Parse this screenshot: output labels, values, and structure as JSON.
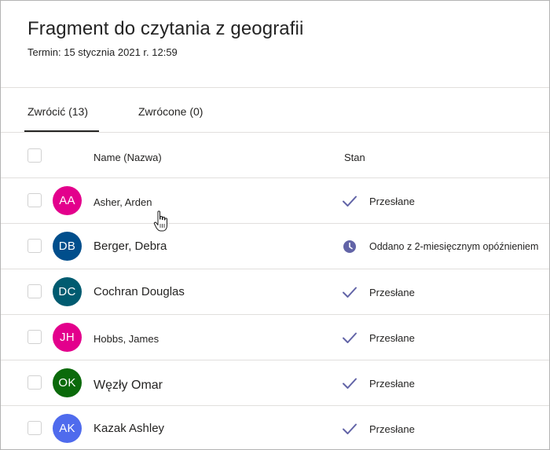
{
  "header": {
    "title": "Fragment do czytania z geografii",
    "due": "Termin: 15 stycznia 2021 r. 12:59"
  },
  "tabs": [
    {
      "label": "Zwrócić (13)",
      "active": true
    },
    {
      "label": "Zwrócone (0)",
      "active": false
    }
  ],
  "columns": {
    "name": "Name (Nazwa)",
    "status": "Stan"
  },
  "students": [
    {
      "initials": "AA",
      "name": "Asher, Arden",
      "status": "Przesłane",
      "status_icon": "check-icon",
      "avatar_color": "#e3008c"
    },
    {
      "initials": "DB",
      "name": "Berger, Debra",
      "status": "Oddano z 2-miesięcznym opóźnieniem",
      "status_icon": "clock-icon",
      "avatar_color": "#004e8c"
    },
    {
      "initials": "DC",
      "name": "Cochran Douglas",
      "status": "Przesłane",
      "status_icon": "check-icon",
      "avatar_color": "#005b70"
    },
    {
      "initials": "JH",
      "name": "Hobbs, James",
      "status": "Przesłane",
      "status_icon": "check-icon",
      "avatar_color": "#e3008c"
    },
    {
      "initials": "OK",
      "name": "Węzły Omar",
      "status": "Przesłane",
      "status_icon": "check-icon",
      "avatar_color": "#0b6a0b"
    },
    {
      "initials": "AK",
      "name": "Kazak Ashley",
      "status": "Przesłane",
      "status_icon": "check-icon",
      "avatar_color": "#4f6bed"
    }
  ],
  "colors": {
    "accent": "#6264a7",
    "divider": "#e1dfdd"
  }
}
